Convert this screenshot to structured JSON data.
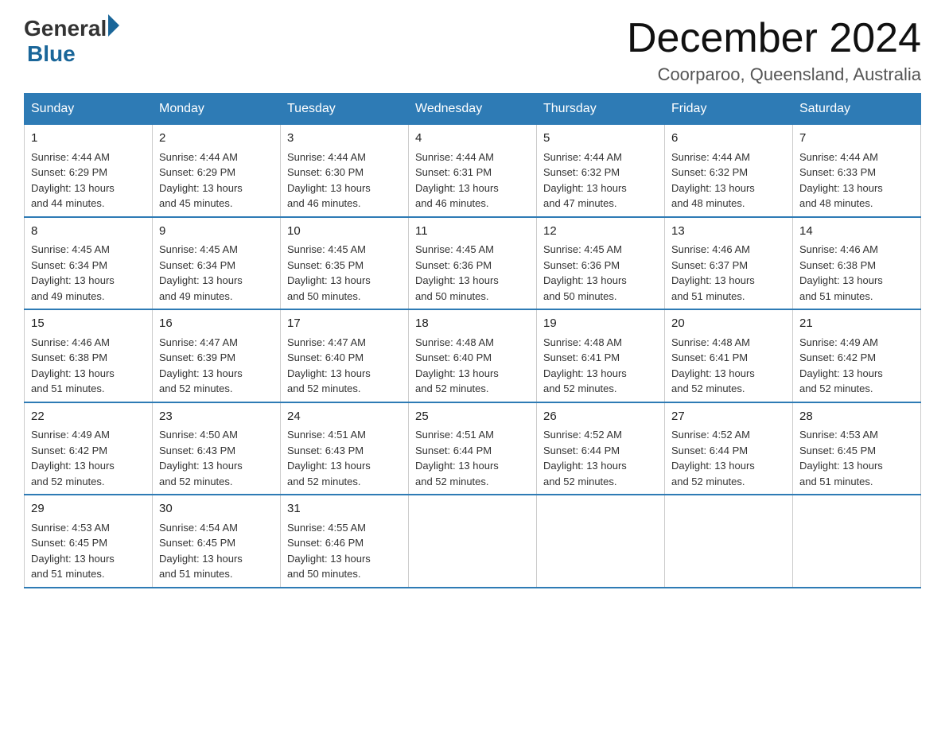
{
  "header": {
    "logo": {
      "general": "General",
      "blue": "Blue"
    },
    "title": "December 2024",
    "subtitle": "Coorparoo, Queensland, Australia"
  },
  "weekdays": [
    "Sunday",
    "Monday",
    "Tuesday",
    "Wednesday",
    "Thursday",
    "Friday",
    "Saturday"
  ],
  "weeks": [
    [
      {
        "day": "1",
        "sunrise": "4:44 AM",
        "sunset": "6:29 PM",
        "daylight": "13 hours and 44 minutes."
      },
      {
        "day": "2",
        "sunrise": "4:44 AM",
        "sunset": "6:29 PM",
        "daylight": "13 hours and 45 minutes."
      },
      {
        "day": "3",
        "sunrise": "4:44 AM",
        "sunset": "6:30 PM",
        "daylight": "13 hours and 46 minutes."
      },
      {
        "day": "4",
        "sunrise": "4:44 AM",
        "sunset": "6:31 PM",
        "daylight": "13 hours and 46 minutes."
      },
      {
        "day": "5",
        "sunrise": "4:44 AM",
        "sunset": "6:32 PM",
        "daylight": "13 hours and 47 minutes."
      },
      {
        "day": "6",
        "sunrise": "4:44 AM",
        "sunset": "6:32 PM",
        "daylight": "13 hours and 48 minutes."
      },
      {
        "day": "7",
        "sunrise": "4:44 AM",
        "sunset": "6:33 PM",
        "daylight": "13 hours and 48 minutes."
      }
    ],
    [
      {
        "day": "8",
        "sunrise": "4:45 AM",
        "sunset": "6:34 PM",
        "daylight": "13 hours and 49 minutes."
      },
      {
        "day": "9",
        "sunrise": "4:45 AM",
        "sunset": "6:34 PM",
        "daylight": "13 hours and 49 minutes."
      },
      {
        "day": "10",
        "sunrise": "4:45 AM",
        "sunset": "6:35 PM",
        "daylight": "13 hours and 50 minutes."
      },
      {
        "day": "11",
        "sunrise": "4:45 AM",
        "sunset": "6:36 PM",
        "daylight": "13 hours and 50 minutes."
      },
      {
        "day": "12",
        "sunrise": "4:45 AM",
        "sunset": "6:36 PM",
        "daylight": "13 hours and 50 minutes."
      },
      {
        "day": "13",
        "sunrise": "4:46 AM",
        "sunset": "6:37 PM",
        "daylight": "13 hours and 51 minutes."
      },
      {
        "day": "14",
        "sunrise": "4:46 AM",
        "sunset": "6:38 PM",
        "daylight": "13 hours and 51 minutes."
      }
    ],
    [
      {
        "day": "15",
        "sunrise": "4:46 AM",
        "sunset": "6:38 PM",
        "daylight": "13 hours and 51 minutes."
      },
      {
        "day": "16",
        "sunrise": "4:47 AM",
        "sunset": "6:39 PM",
        "daylight": "13 hours and 52 minutes."
      },
      {
        "day": "17",
        "sunrise": "4:47 AM",
        "sunset": "6:40 PM",
        "daylight": "13 hours and 52 minutes."
      },
      {
        "day": "18",
        "sunrise": "4:48 AM",
        "sunset": "6:40 PM",
        "daylight": "13 hours and 52 minutes."
      },
      {
        "day": "19",
        "sunrise": "4:48 AM",
        "sunset": "6:41 PM",
        "daylight": "13 hours and 52 minutes."
      },
      {
        "day": "20",
        "sunrise": "4:48 AM",
        "sunset": "6:41 PM",
        "daylight": "13 hours and 52 minutes."
      },
      {
        "day": "21",
        "sunrise": "4:49 AM",
        "sunset": "6:42 PM",
        "daylight": "13 hours and 52 minutes."
      }
    ],
    [
      {
        "day": "22",
        "sunrise": "4:49 AM",
        "sunset": "6:42 PM",
        "daylight": "13 hours and 52 minutes."
      },
      {
        "day": "23",
        "sunrise": "4:50 AM",
        "sunset": "6:43 PM",
        "daylight": "13 hours and 52 minutes."
      },
      {
        "day": "24",
        "sunrise": "4:51 AM",
        "sunset": "6:43 PM",
        "daylight": "13 hours and 52 minutes."
      },
      {
        "day": "25",
        "sunrise": "4:51 AM",
        "sunset": "6:44 PM",
        "daylight": "13 hours and 52 minutes."
      },
      {
        "day": "26",
        "sunrise": "4:52 AM",
        "sunset": "6:44 PM",
        "daylight": "13 hours and 52 minutes."
      },
      {
        "day": "27",
        "sunrise": "4:52 AM",
        "sunset": "6:44 PM",
        "daylight": "13 hours and 52 minutes."
      },
      {
        "day": "28",
        "sunrise": "4:53 AM",
        "sunset": "6:45 PM",
        "daylight": "13 hours and 51 minutes."
      }
    ],
    [
      {
        "day": "29",
        "sunrise": "4:53 AM",
        "sunset": "6:45 PM",
        "daylight": "13 hours and 51 minutes."
      },
      {
        "day": "30",
        "sunrise": "4:54 AM",
        "sunset": "6:45 PM",
        "daylight": "13 hours and 51 minutes."
      },
      {
        "day": "31",
        "sunrise": "4:55 AM",
        "sunset": "6:46 PM",
        "daylight": "13 hours and 50 minutes."
      },
      null,
      null,
      null,
      null
    ]
  ],
  "labels": {
    "sunrise": "Sunrise:",
    "sunset": "Sunset:",
    "daylight": "Daylight:"
  }
}
